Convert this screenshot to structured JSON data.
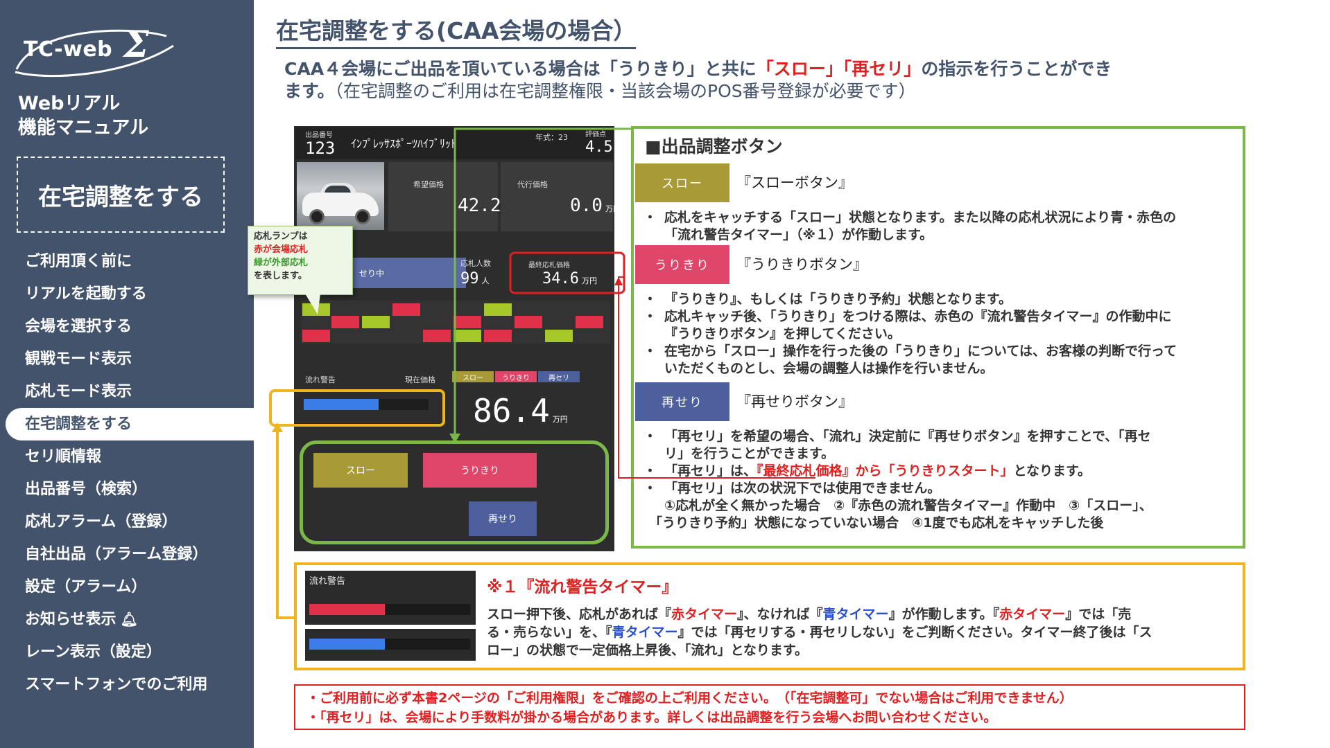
{
  "sidebar": {
    "logo_text": "TC-web",
    "logo_sigma": "Σ",
    "manual_title_1": "Webリアル",
    "manual_title_2": "機能マニュアル",
    "current_section": "在宅調整をする",
    "items": [
      {
        "label": "ご利用頂く前に"
      },
      {
        "label": "リアルを起動する"
      },
      {
        "label": "会場を選択する"
      },
      {
        "label": "観戦モード表示"
      },
      {
        "label": "応札モード表示"
      },
      {
        "label": "在宅調整をする"
      },
      {
        "label": "セリ順情報"
      },
      {
        "label": "出品番号（検索）"
      },
      {
        "label": "応札アラーム（登録）"
      },
      {
        "label": "自社出品（アラーム登録）"
      },
      {
        "label": "設定（アラーム）"
      },
      {
        "label": "お知らせ表示"
      },
      {
        "label": "レーン表示（設定）"
      },
      {
        "label": "スマートフォンでのご利用"
      }
    ]
  },
  "main": {
    "title": "在宅調整をする(CAA会場の場合）",
    "intro_1": "CAA４会場にご出品を頂いている場合は「うりきり」と共に",
    "intro_red": "「スロー」「再セリ」",
    "intro_2": "の指示を行うことができ",
    "intro_3": "ます。",
    "intro_4": "（在宅調整のご利用は在宅調整権限・当該会場のPOS番号登録が必要です）"
  },
  "app": {
    "lot_label": "出品番号",
    "lot_number": "123",
    "car_name": "ｲﾝﾌﾟﾚｯｻｽﾎﾟｰﾂﾊｲﾌﾞﾘｯﾄ",
    "year_label": "年式：23",
    "grade_label": "評価点",
    "grade_value": "4.5",
    "desired_label": "希望価格",
    "desired_value": "42.2",
    "proxy_label": "代行価格",
    "proxy_value": "0.0",
    "unit_man": "万円",
    "status": "せり中",
    "bidders_label": "応札人数",
    "bidders_value": "99",
    "bidders_unit": "人",
    "final_label": "最終応札価格",
    "final_value": "34.6",
    "warning_label": "流れ警告",
    "current_label": "現在価格",
    "current_value": "86.4",
    "tag_slow": "スロー",
    "tag_urikiri": "うりきり",
    "tag_reseri": "再セリ",
    "btn_slow": "スロー",
    "btn_urikiri": "うりきり",
    "btn_reseri": "再せり",
    "timer_fill": 0.6
  },
  "callout": {
    "line1": "応札ランプは",
    "line2": "赤が会場応札",
    "line3": "緑が外部応札",
    "line4": "を表します。"
  },
  "panel": {
    "title": "■出品調整ボタン",
    "slow_btn": "スロー",
    "slow_name": "『スローボタン』",
    "slow_desc_1": "応札をキャッチする「スロー」状態となります。また以降の応札状況により青・赤色の",
    "slow_desc_2": "「流れ警告タイマー」（※１）が作動します。",
    "urikiri_btn": "うりきり",
    "urikiri_name": "『うりきりボタン』",
    "urikiri_desc_1": "『うりきり』、もしくは「うりきり予約」状態となります。",
    "urikiri_desc_2a": "応札キャッチ後、「うりきり」をつける際は、赤色の『流れ警告タイマー』の作動中に",
    "urikiri_desc_2b": "『うりきりボタン』を押してください。",
    "urikiri_desc_3a": "在宅から「スロー」操作を行った後の「うりきり」については、お客様の判断で行って",
    "urikiri_desc_3b": "いただくものとし、会場の調整人は操作を行いません。",
    "reseri_btn": "再せり",
    "reseri_name": "『再せりボタン』",
    "reseri_desc_1a": "「再セリ」を希望の場合、「流れ」決定前に『再せりボタン』を押すことで、「再セ",
    "reseri_desc_1b": "リ」を行うことができます。",
    "reseri_desc_2a": "「再セリ」は、",
    "reseri_desc_2red": "『最終応札価格』から「うりきりスタート」",
    "reseri_desc_2b": "となります。",
    "reseri_desc_3": "「再セリ」は次の状況下では使用できません。",
    "reseri_desc_4": "①応札が全く無かった場合　②『赤色の流れ警告タイマー』作動中　③「スロー」、",
    "reseri_desc_5": "「うりきり予約」状態になっていない場合　④1度でも応札をキャッチした後"
  },
  "timer": {
    "img_label": "流れ警告",
    "title": "※１『流れ警告タイマー』",
    "l1a": "スロー押下後、応札があれば『",
    "l1red": "赤タイマー",
    "l1b": "』、なければ『",
    "l1blue": "青タイマー",
    "l1c": "』が作動します。『",
    "l1red2": "赤タイマー",
    "l1d": "』では「売",
    "l2a": "る・売らない」を、『",
    "l2blue": "青タイマー",
    "l2b": "』では「再セリする・再セリしない」をご判断ください。タイマー終了後は「ス",
    "l3": "ロー」の状態で一定価格上昇後、「流れ」となります。",
    "red_fill": 0.47,
    "blue_fill": 0.47
  },
  "notes": {
    "line1": "・ご利用前に必ず本書2ページの「ご利用権限」をご確認の上ご利用ください。　（「在宅調整可」でない場合はご利用できません）",
    "line2": "・「再セリ」は、会場により手数料が掛かる場合があります。詳しくは出品調整を行う会場へお問い合わせください。"
  },
  "colors": {
    "sidebar": "#44536c",
    "green_frame": "#7bb84a",
    "yellow_frame": "#f0b51e",
    "red": "#e02020",
    "blue_timer": "#3a7de8",
    "slow_btn": "#a89a36",
    "urikiri_btn": "#e0456a",
    "reseri_btn": "#4d5f9c"
  }
}
